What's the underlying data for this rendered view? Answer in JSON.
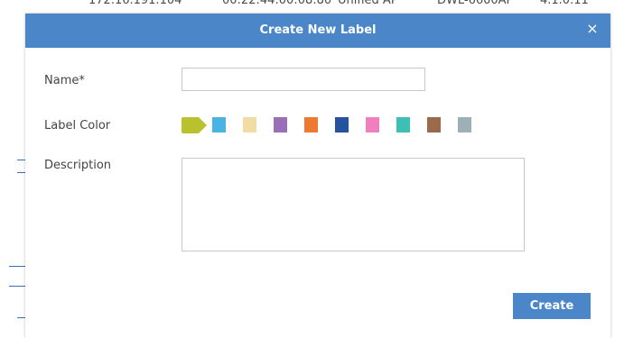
{
  "background_row": {
    "ip": "172.16.191.104",
    "mac": "00:22:44:00:08:80",
    "type": "Unified AP",
    "model": "DWL-6600AP",
    "version": "4.1.0.11"
  },
  "modal": {
    "title": "Create New Label",
    "close_icon": "×",
    "name_label": "Name*",
    "name_value": "",
    "color_label": "Label Color",
    "description_label": "Description",
    "description_value": "",
    "create_label": "Create"
  },
  "colors": {
    "header": "#4a86c8",
    "button": "#4a86c8",
    "swatches": [
      {
        "name": "olive",
        "hex": "#b9c12c",
        "selected": true
      },
      {
        "name": "sky-blue",
        "hex": "#47b4e2",
        "selected": false
      },
      {
        "name": "wheat",
        "hex": "#f1dda4",
        "selected": false
      },
      {
        "name": "purple",
        "hex": "#9b6fb5",
        "selected": false
      },
      {
        "name": "orange",
        "hex": "#ee7a31",
        "selected": false
      },
      {
        "name": "dark-blue",
        "hex": "#26539e",
        "selected": false
      },
      {
        "name": "pink",
        "hex": "#f07fbd",
        "selected": false
      },
      {
        "name": "teal",
        "hex": "#3dbfb3",
        "selected": false
      },
      {
        "name": "brown",
        "hex": "#9a6a4a",
        "selected": false
      },
      {
        "name": "gray",
        "hex": "#9db0b6",
        "selected": false
      }
    ]
  }
}
